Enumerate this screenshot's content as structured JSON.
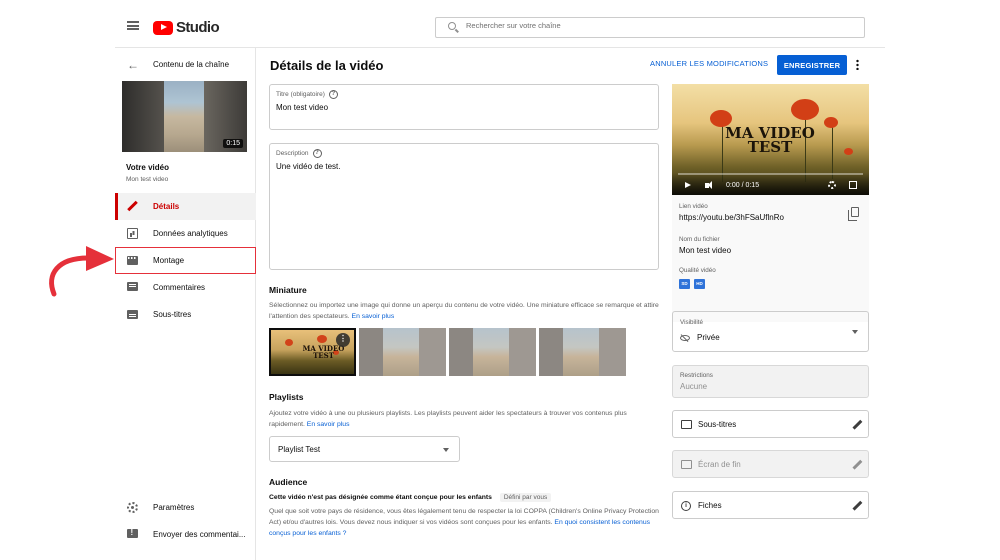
{
  "header": {
    "logo_text": "Studio",
    "search_placeholder": "Rechercher sur votre chaîne"
  },
  "sidebar": {
    "back_label": "Contenu de la chaîne",
    "thumb_duration": "0:15",
    "your_video_label": "Votre vidéo",
    "video_title": "Mon test video",
    "items": [
      {
        "label": "Détails",
        "icon": "pencil-icon",
        "active": true
      },
      {
        "label": "Données analytiques",
        "icon": "analytics-icon"
      },
      {
        "label": "Montage",
        "icon": "editor-icon",
        "highlighted": true
      },
      {
        "label": "Commentaires",
        "icon": "comments-icon"
      },
      {
        "label": "Sous-titres",
        "icon": "subtitles-icon"
      }
    ],
    "bottom_items": [
      {
        "label": "Paramètres",
        "icon": "gear-icon"
      },
      {
        "label": "Envoyer des commentai...",
        "icon": "feedback-icon"
      }
    ]
  },
  "main": {
    "title": "Détails de la vidéo",
    "undo_label": "ANNULER LES MODIFICATIONS",
    "save_label": "ENREGISTRER",
    "title_field": {
      "label": "Titre (obligatoire)",
      "value": "Mon test video"
    },
    "description_field": {
      "label": "Description",
      "value": "Une vidéo de test."
    },
    "thumbnail": {
      "heading": "Miniature",
      "text": "Sélectionnez ou importez une image qui donne un aperçu du contenu de votre vidéo. Une miniature efficace se remarque et attire l'attention des spectateurs.",
      "link": "En savoir plus",
      "selected_text": "MA VIDEO TEST"
    },
    "playlists": {
      "heading": "Playlists",
      "text": "Ajoutez votre vidéo à une ou plusieurs playlists. Les playlists peuvent aider les spectateurs à trouver vos contenus plus rapidement.",
      "link": "En savoir plus",
      "selected": "Playlist Test"
    },
    "audience": {
      "heading": "Audience",
      "subheading": "Cette vidéo n'est pas désignée comme étant conçue pour les enfants",
      "badge": "Défini par vous",
      "text": "Quel que soit votre pays de résidence, vous êtes légalement tenu de respecter la loi COPPA (Children's Online Privacy Protection Act) et/ou d'autres lois. Vous devez nous indiquer si vos vidéos sont conçues pour les enfants.",
      "link": "En quoi consistent les contenus conçus pour les enfants ?"
    }
  },
  "right": {
    "player_title": "MA VIDEO TEST",
    "player_time": "0:00 / 0:15",
    "link_label": "Lien vidéo",
    "link_value": "https://youtu.be/3hFSaUflnRo",
    "filename_label": "Nom du fichier",
    "filename_value": "Mon test video",
    "quality_label": "Qualité vidéo",
    "quality_badges": [
      "SD",
      "HD"
    ],
    "visibility_label": "Visibilité",
    "visibility_value": "Privée",
    "restrictions_label": "Restrictions",
    "restrictions_value": "Aucune",
    "subtitles_label": "Sous-titres",
    "endscreen_label": "Écran de fin",
    "cards_label": "Fiches"
  },
  "colors": {
    "accent": "#065fd4",
    "brand": "#ff0000",
    "active": "#cc0000",
    "annotation": "#e5303a"
  }
}
